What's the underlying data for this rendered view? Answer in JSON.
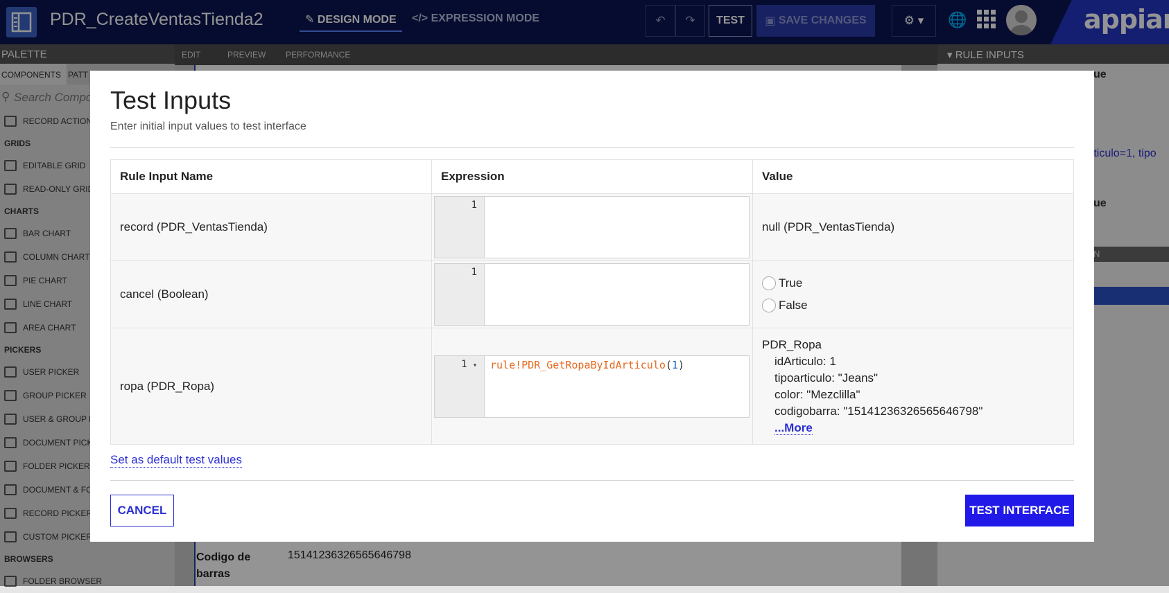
{
  "topbar": {
    "title": "PDR_CreateVentasTienda2",
    "design_mode": "DESIGN MODE",
    "expression_mode": "EXPRESSION MODE",
    "undo_icon": "undo-icon",
    "redo_icon": "redo-icon",
    "test": "TEST",
    "save_changes": "SAVE CHANGES",
    "logo": "appian"
  },
  "palette": {
    "header": "PALETTE",
    "tabs": [
      "COMPONENTS",
      "PATT"
    ],
    "search_placeholder": "Search Compo",
    "items": [
      {
        "kind": "item",
        "label": "RECORD ACTION"
      },
      {
        "kind": "section",
        "label": "GRIDS"
      },
      {
        "kind": "item",
        "label": "EDITABLE GRID"
      },
      {
        "kind": "item",
        "label": "READ-ONLY GRID"
      },
      {
        "kind": "section",
        "label": "CHARTS"
      },
      {
        "kind": "item",
        "label": "BAR CHART"
      },
      {
        "kind": "item",
        "label": "COLUMN CHART"
      },
      {
        "kind": "item",
        "label": "PIE CHART"
      },
      {
        "kind": "item",
        "label": "LINE CHART"
      },
      {
        "kind": "item",
        "label": "AREA CHART"
      },
      {
        "kind": "section",
        "label": "PICKERS"
      },
      {
        "kind": "item",
        "label": "USER PICKER"
      },
      {
        "kind": "item",
        "label": "GROUP PICKER"
      },
      {
        "kind": "item",
        "label": "USER & GROUP P"
      },
      {
        "kind": "item",
        "label": "DOCUMENT PICK"
      },
      {
        "kind": "item",
        "label": "FOLDER PICKER"
      },
      {
        "kind": "item",
        "label": "DOCUMENT & FO"
      },
      {
        "kind": "item",
        "label": "RECORD PICKER"
      },
      {
        "kind": "item",
        "label": "CUSTOM PICKER"
      },
      {
        "kind": "section",
        "label": "BROWSERS"
      },
      {
        "kind": "item",
        "label": "FOLDER BROWSER"
      }
    ]
  },
  "canvas": {
    "tabs": [
      "EDIT",
      "PREVIEW",
      "PERFORMANCE"
    ],
    "field_label": "Codigo de barras",
    "field_value": "15141236326565646798"
  },
  "right_panel": {
    "header": "RULE INPUTS",
    "partial_1": "ue",
    "partial_2": "rticulo=1, tipo",
    "partial_3": "ue",
    "partial_4": "N"
  },
  "modal": {
    "title": "Test Inputs",
    "subtitle": "Enter initial input values to test interface",
    "columns": [
      "Rule Input Name",
      "Expression",
      "Value"
    ],
    "rows": [
      {
        "name": "record (PDR_VentasTienda)",
        "line": "1",
        "expression": "",
        "value": "null (PDR_VentasTienda)"
      },
      {
        "name": "cancel (Boolean)",
        "line": "1",
        "expression": "",
        "options": [
          "True",
          "False"
        ]
      },
      {
        "name": "ropa (PDR_Ropa)",
        "line": "1",
        "fold": "▾",
        "expression_fn": "rule!PDR_GetRopaByIdArticulo",
        "expression_open": "(",
        "expression_arg": "1",
        "expression_close": ")",
        "value_title": "PDR_Ropa",
        "value_fields": [
          "idArticulo: 1",
          "tipoarticulo: \"Jeans\"",
          "color: \"Mezclilla\"",
          "codigobarra: \"15141236326565646798\""
        ],
        "more": "...More"
      }
    ],
    "default_link": "Set as default test values",
    "cancel": "CANCEL",
    "test_interface": "TEST INTERFACE"
  }
}
